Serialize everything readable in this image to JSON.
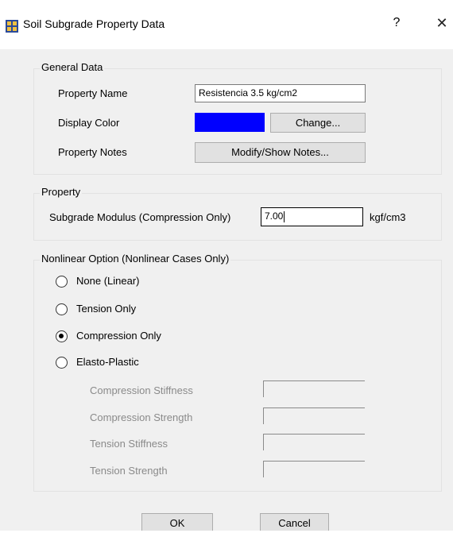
{
  "window": {
    "title": "Soil Subgrade Property Data",
    "help_label": "?",
    "close_label": "✕"
  },
  "general_data": {
    "legend": "General Data",
    "property_name_label": "Property Name",
    "property_name_value": "Resistencia 3.5 kg/cm2",
    "display_color_label": "Display Color",
    "display_color": "#0000ff",
    "change_button": "Change...",
    "property_notes_label": "Property Notes",
    "notes_button": "Modify/Show Notes..."
  },
  "property": {
    "legend": "Property",
    "subgrade_label": "Subgrade Modulus  (Compression Only)",
    "subgrade_value": "7.00",
    "unit": "kgf/cm3"
  },
  "nonlinear": {
    "legend": "Nonlinear Option  (Nonlinear Cases Only)",
    "options": [
      {
        "label": "None (Linear)",
        "checked": false
      },
      {
        "label": "Tension Only",
        "checked": false
      },
      {
        "label": "Compression Only",
        "checked": true
      },
      {
        "label": "Elasto-Plastic",
        "checked": false
      }
    ],
    "fields": [
      {
        "label": "Compression Stiffness",
        "value": ""
      },
      {
        "label": "Compression Strength",
        "value": ""
      },
      {
        "label": "Tension Stiffness",
        "value": ""
      },
      {
        "label": "Tension Strength",
        "value": ""
      }
    ]
  },
  "buttons": {
    "ok": "OK",
    "cancel": "Cancel"
  }
}
